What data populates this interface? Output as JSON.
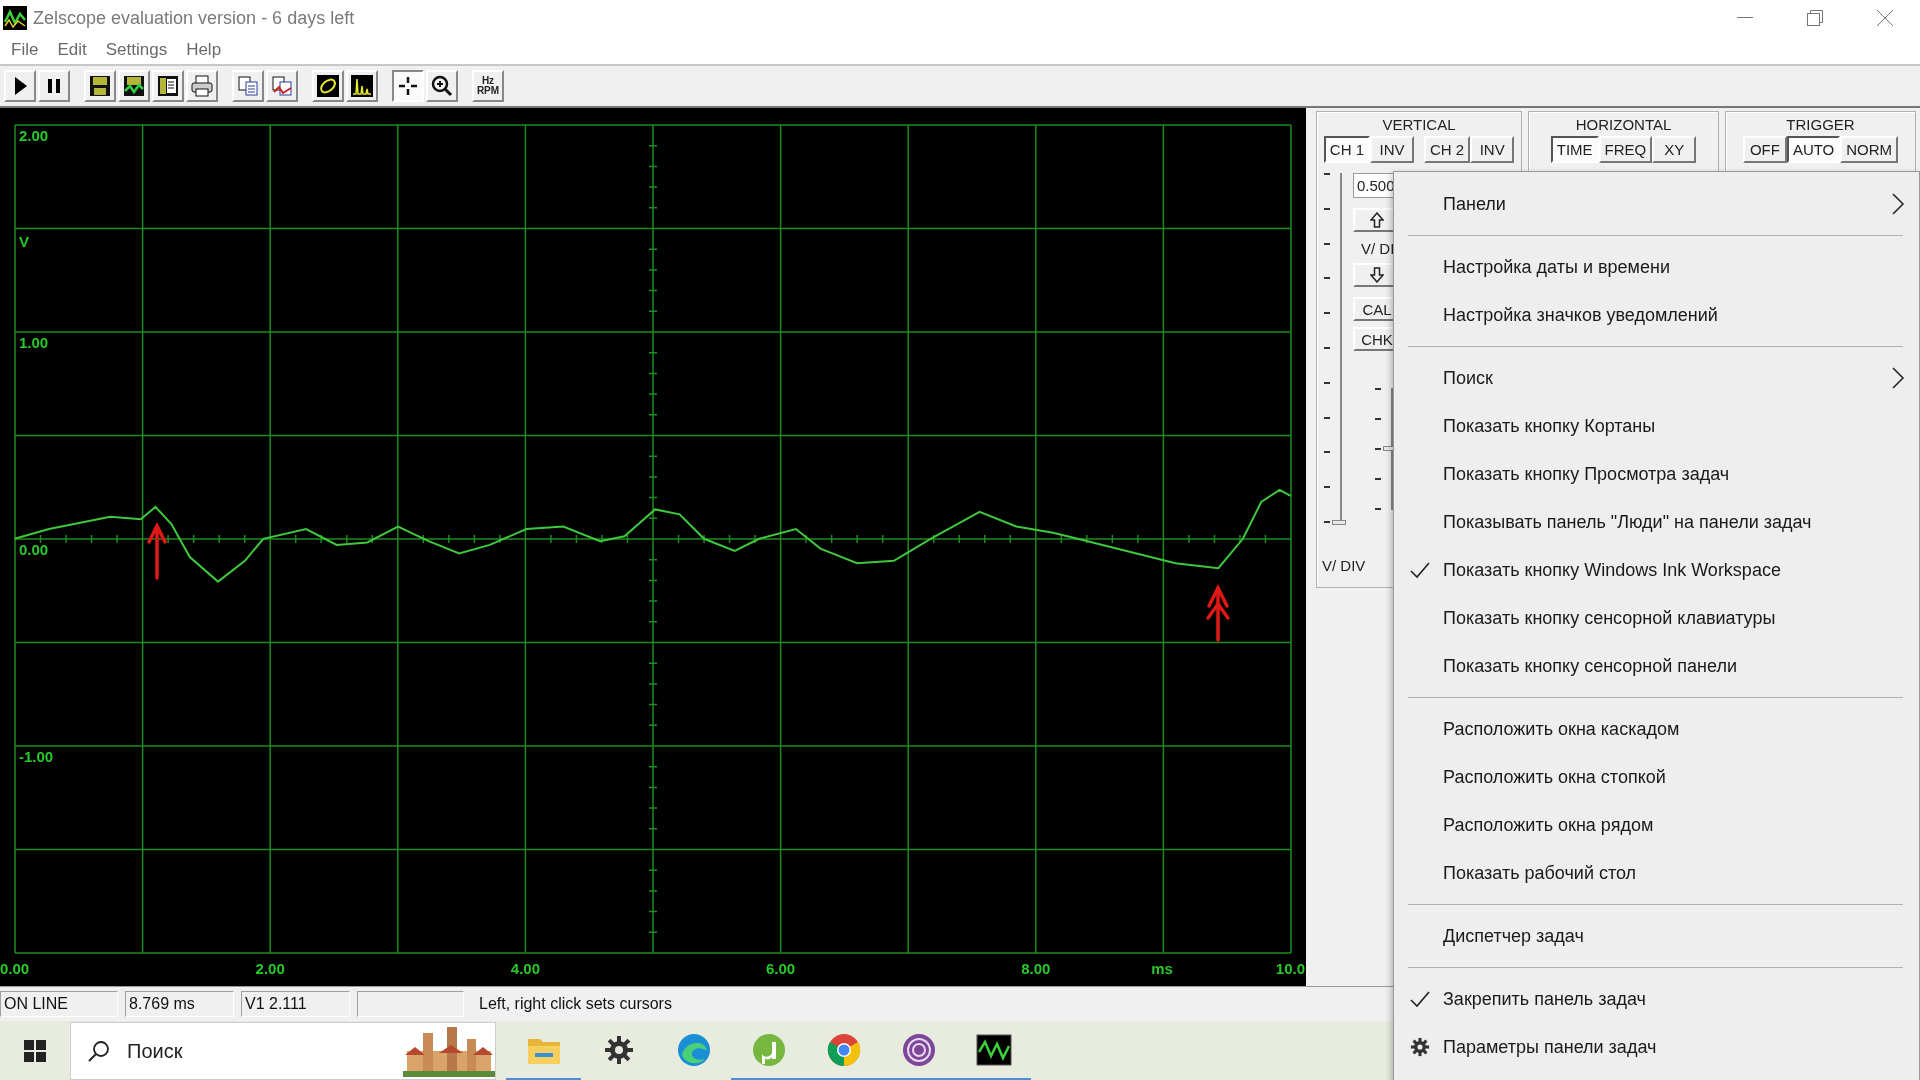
{
  "window": {
    "title": "Zelscope evaluation version - 6 days left"
  },
  "menu_bar": [
    "File",
    "Edit",
    "Settings",
    "Help"
  ],
  "toolbar": {
    "cursor_button_pressed": true,
    "units_button": [
      "Hz",
      "RPM"
    ]
  },
  "scope": {
    "y_labels": [
      "2.00",
      "V",
      "1.00",
      "0.00",
      "-1.00"
    ],
    "x_labels": [
      "0.00",
      "2.00",
      "4.00",
      "6.00",
      "8.00",
      "ms",
      "10.0"
    ]
  },
  "vertical": {
    "title": "VERTICAL",
    "buttons": [
      {
        "label": "CH 1",
        "selected": true
      },
      {
        "label": "INV",
        "selected": false
      },
      {
        "label": "CH 2",
        "selected": false
      },
      {
        "label": "INV",
        "selected": false
      }
    ],
    "scale_value": "0.500",
    "scale_label": "V/ DI",
    "cal_button": "CAL",
    "chk_button": "CHK",
    "sliders": [
      {
        "level": 0
      },
      {
        "level": 0.5
      }
    ],
    "footer_label": "V/ DIV"
  },
  "horizontal": {
    "title": "HORIZONTAL",
    "buttons": [
      {
        "label": "TIME",
        "selected": true
      },
      {
        "label": "FREQ",
        "selected": false
      },
      {
        "label": "XY",
        "selected": false
      }
    ]
  },
  "trigger": {
    "title": "TRIGGER",
    "buttons": [
      {
        "label": "OFF",
        "selected": false
      },
      {
        "label": "AUTO",
        "selected": true
      },
      {
        "label": "NORM",
        "selected": false
      }
    ]
  },
  "status_bar": {
    "fields": [
      "ON LINE",
      "8.769 ms",
      "V1 2.111"
    ],
    "message": "Left, right click sets cursors"
  },
  "taskbar": {
    "search": {
      "placeholder": "Поиск"
    },
    "apps": [
      {
        "running": true
      },
      {
        "running": false
      },
      {
        "running": false
      },
      {
        "running": true
      },
      {
        "running": true
      },
      {
        "running": true
      },
      {
        "running": true
      }
    ]
  },
  "context_menu": {
    "items": [
      {
        "kind": "command",
        "label": "Панели",
        "submenu": true,
        "checked": false
      },
      {
        "kind": "separator"
      },
      {
        "kind": "command",
        "label": "Настройка даты и времени",
        "submenu": false,
        "checked": false
      },
      {
        "kind": "command",
        "label": "Настройка значков уведомлений",
        "submenu": false,
        "checked": false
      },
      {
        "kind": "separator"
      },
      {
        "kind": "command",
        "label": "Поиск",
        "submenu": true,
        "checked": false
      },
      {
        "kind": "command",
        "label": "Показать кнопку Кортаны",
        "submenu": false,
        "checked": false
      },
      {
        "kind": "command",
        "label": "Показать кнопку Просмотра задач",
        "submenu": false,
        "checked": false
      },
      {
        "kind": "command",
        "label": "Показывать панель \"Люди\" на панели задач",
        "submenu": false,
        "checked": false
      },
      {
        "kind": "command",
        "label": "Показать кнопку Windows Ink Workspace",
        "submenu": false,
        "checked": true
      },
      {
        "kind": "command",
        "label": "Показать кнопку сенсорной клавиатуры",
        "submenu": false,
        "checked": false
      },
      {
        "kind": "command",
        "label": "Показать кнопку сенсорной панели",
        "submenu": false,
        "checked": false
      },
      {
        "kind": "separator"
      },
      {
        "kind": "command",
        "label": "Расположить окна каскадом",
        "submenu": false,
        "checked": false
      },
      {
        "kind": "command",
        "label": "Расположить окна стопкой",
        "submenu": false,
        "checked": false
      },
      {
        "kind": "command",
        "label": "Расположить окна рядом",
        "submenu": false,
        "checked": false
      },
      {
        "kind": "command",
        "label": "Показать рабочий стол",
        "submenu": false,
        "checked": false
      },
      {
        "kind": "separator"
      },
      {
        "kind": "command",
        "label": "Диспетчер задач",
        "submenu": false,
        "checked": false
      },
      {
        "kind": "separator"
      },
      {
        "kind": "command",
        "label": "Закрепить панель задач",
        "submenu": false,
        "checked": true
      },
      {
        "kind": "settings",
        "label": "Параметры панели задач",
        "submenu": false,
        "checked": false
      }
    ]
  }
}
